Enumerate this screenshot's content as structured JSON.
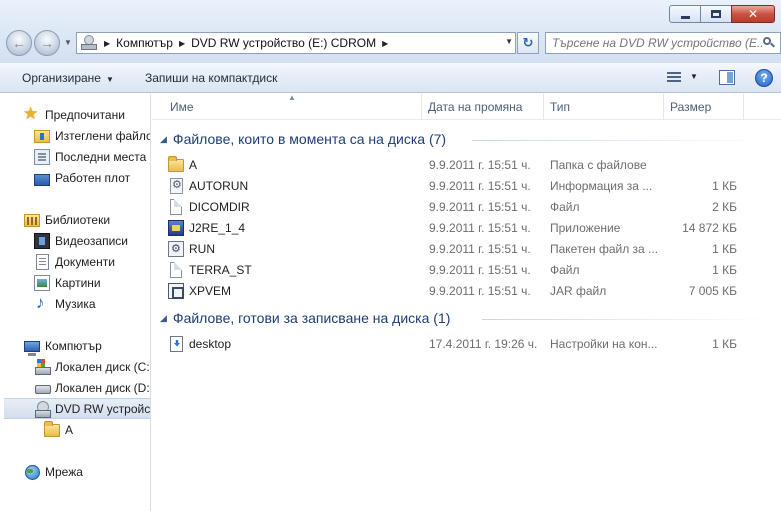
{
  "window": {
    "minimize_label": "–",
    "maximize_label": "□",
    "close_label": "✕"
  },
  "address": {
    "crumbs": [
      "Компютър",
      "DVD RW устройство (E:) CDROM"
    ]
  },
  "search": {
    "placeholder": "Търсене на DVD RW устройство (E..."
  },
  "toolbar": {
    "organize_label": "Организиране",
    "burn_label": "Запиши на компактдиск"
  },
  "sidebar": {
    "favorites": {
      "label": "Предпочитани",
      "items": [
        "Изтеглени файлове",
        "Последни места",
        "Работен плот"
      ]
    },
    "libraries": {
      "label": "Библиотеки",
      "items": [
        "Видеозаписи",
        "Документи",
        "Картини",
        "Музика"
      ]
    },
    "computer": {
      "label": "Компютър",
      "items": [
        "Локален диск (C:)",
        "Локален диск (D:)",
        "DVD RW устройство (E:) CDROM"
      ],
      "subitems": [
        "A"
      ]
    },
    "network": {
      "label": "Мрежа"
    }
  },
  "columns": {
    "name": "Име",
    "date": "Дата на промяна",
    "type": "Тип",
    "size": "Размер"
  },
  "groups": [
    {
      "title": "Файлове, които в момента са на диска (7)",
      "files": [
        {
          "name": "A",
          "date": "9.9.2011 г. 15:51 ч.",
          "type": "Папка с файлове",
          "size": "",
          "icon": "folder-icon"
        },
        {
          "name": "AUTORUN",
          "date": "9.9.2011 г. 15:51 ч.",
          "type": "Информация за ...",
          "size": "1 КБ",
          "icon": "autorun-icon"
        },
        {
          "name": "DICOMDIR",
          "date": "9.9.2011 г. 15:51 ч.",
          "type": "Файл",
          "size": "2 КБ",
          "icon": "file-icon"
        },
        {
          "name": "J2RE_1_4",
          "date": "9.9.2011 г. 15:51 ч.",
          "type": "Приложение",
          "size": "14 872 КБ",
          "icon": "application-icon"
        },
        {
          "name": "RUN",
          "date": "9.9.2011 г. 15:51 ч.",
          "type": "Пакетен файл за ...",
          "size": "1 КБ",
          "icon": "batch-file-icon"
        },
        {
          "name": "TERRA_ST",
          "date": "9.9.2011 г. 15:51 ч.",
          "type": "Файл",
          "size": "1 КБ",
          "icon": "file-icon"
        },
        {
          "name": "XPVEM",
          "date": "9.9.2011 г. 15:51 ч.",
          "type": "JAR файл",
          "size": "7 005 КБ",
          "icon": "jar-file-icon"
        }
      ]
    },
    {
      "title": "Файлове, готови за записване на диска (1)",
      "files": [
        {
          "name": "desktop",
          "date": "17.4.2011 г. 19:26 ч.",
          "type": "Настройки на кон...",
          "size": "1 КБ",
          "icon": "settings-file-icon"
        }
      ]
    }
  ]
}
